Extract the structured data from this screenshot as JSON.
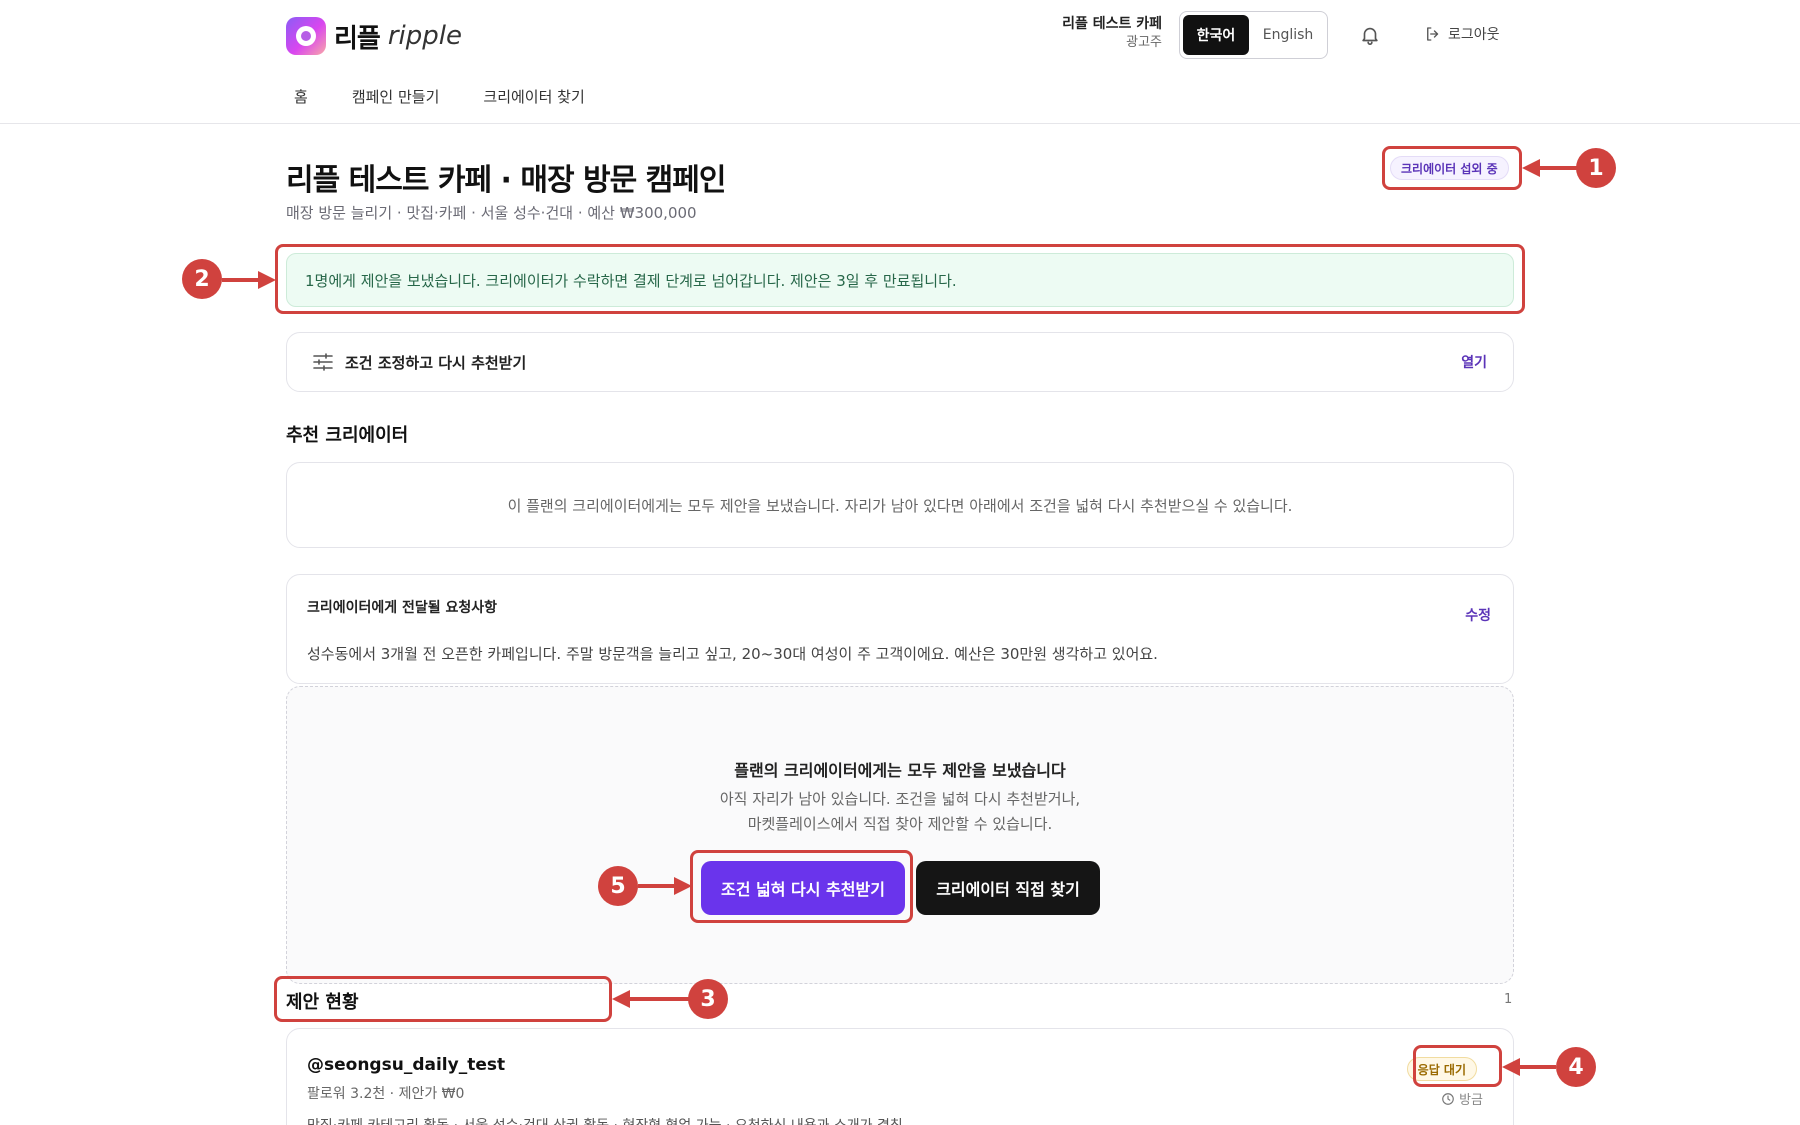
{
  "header": {
    "logo_ko": "리플",
    "logo_en": "ripple",
    "account_name": "리플 테스트 카페",
    "account_role": "광고주",
    "lang_ko": "한국어",
    "lang_en": "English",
    "logout": "로그아웃"
  },
  "nav": {
    "items": [
      "홈",
      "캠페인 만들기",
      "크리에이터 찾기"
    ]
  },
  "campaign": {
    "title": "리플 테스트 카페 · 매장 방문 캠페인",
    "subtitle": "매장 방문 늘리기 · 맛집·카페 · 서울 성수·건대 · 예산 ₩300,000",
    "status": "크리에이터 섭외 중"
  },
  "notice": "1명에게 제안을 보냈습니다. 크리에이터가 수락하면 결제 단계로 넘어갑니다. 제안은 3일 후 만료됩니다.",
  "adjust": {
    "label": "조건 조정하고 다시 추천받기",
    "action": "열기"
  },
  "recommend": {
    "title": "추천 크리에이터",
    "empty": "이 플랜의 크리에이터에게는 모두 제안을 보냈습니다. 자리가 남아 있다면 아래에서 조건을 넓혀 다시 추천받으실 수 있습니다."
  },
  "request": {
    "title": "크리에이터에게 전달될 요청사항",
    "edit": "수정",
    "body": "성수동에서 3개월 전 오픈한 카페입니다. 주말 방문객을 늘리고 싶고, 20~30대 여성이 주 고객이에요. 예산은 30만원 생각하고 있어요."
  },
  "cta": {
    "title": "플랜의 크리에이터에게는 모두 제안을 보냈습니다",
    "desc_line1": "아직 자리가 남아 있습니다. 조건을 넓혀 다시 추천받거나,",
    "desc_line2": "마켓플레이스에서 직접 찾아 제안할 수 있습니다.",
    "primary": "조건 넓혀 다시 추천받기",
    "secondary": "크리에이터 직접 찾기"
  },
  "offers": {
    "title": "제안 현황",
    "count": "1",
    "items": [
      {
        "handle": "@seongsu_daily_test",
        "meta": "팔로워 3.2천 · 제안가 ₩0",
        "tags": "맛집·카페 카테고리 활동 · 서울 성수·건대 상권 활동 · 현장형 협업 가능 · 요청하신 내용과 소개가 겹침",
        "status": "응답 대기",
        "time": "방금"
      }
    ]
  },
  "annotations": [
    "1",
    "2",
    "3",
    "4",
    "5"
  ],
  "colors": {
    "accent": "#6a34ec",
    "annotation": "#d0423e",
    "notice_bg": "#edfbf3",
    "notice_text": "#276749"
  },
  "icons": [
    "logo-icon",
    "bell-icon",
    "logout-icon",
    "sliders-icon",
    "clock-icon"
  ]
}
